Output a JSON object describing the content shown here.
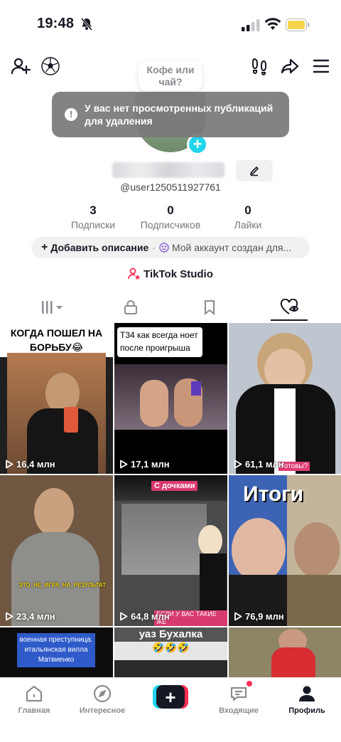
{
  "status_bar": {
    "time": "19:48"
  },
  "header": {
    "bubble_text": "Кофе или чай?"
  },
  "toast": {
    "icon": "!",
    "message": "У вас нет просмотренных публикаций для удаления"
  },
  "profile": {
    "username": "@user1250511927761",
    "stats": [
      {
        "value": "3",
        "label": "Подписки"
      },
      {
        "value": "0",
        "label": "Подписчиков"
      },
      {
        "value": "0",
        "label": "Лайки"
      }
    ],
    "add_description": "Добавить описание",
    "separator": "·",
    "account_created": "Мой аккаунт создан для...",
    "studio_label": "TikTok Studio"
  },
  "videos": [
    {
      "views": "16,4 млн",
      "caption": "КОГДА ПОШЕЛ НА БОРЬБУ😂"
    },
    {
      "views": "17,1 млн",
      "caption": "T34 как всегда ноет после проигрыша"
    },
    {
      "views": "61,1 млн",
      "caption": "Готовы?"
    },
    {
      "views": "23,4 млн",
      "caption": "ЭТО_НЕ_ИГРА_НА_РЕЗУЛЬТАТ"
    },
    {
      "views": "64,8 млн",
      "caption": "С дочками",
      "caption2": "ЕСЛИ У ВАС ТАКИЕ ЖЕ"
    },
    {
      "views": "76,9 млн",
      "caption": "Итоги"
    },
    {
      "views": "",
      "caption": "военная преступница. итальянская вилла Матвиенко"
    },
    {
      "views": "",
      "caption": "уаз Бухалка",
      "caption2": "🤣🤣🤣"
    },
    {
      "views": "",
      "caption": ""
    }
  ],
  "bottom_nav": [
    {
      "label": "Главная",
      "icon": "home-icon"
    },
    {
      "label": "Интересное",
      "icon": "compass-icon"
    },
    {
      "label": "",
      "icon": "plus-icon"
    },
    {
      "label": "Входящие",
      "icon": "inbox-icon"
    },
    {
      "label": "Профиль",
      "icon": "profile-icon"
    }
  ]
}
